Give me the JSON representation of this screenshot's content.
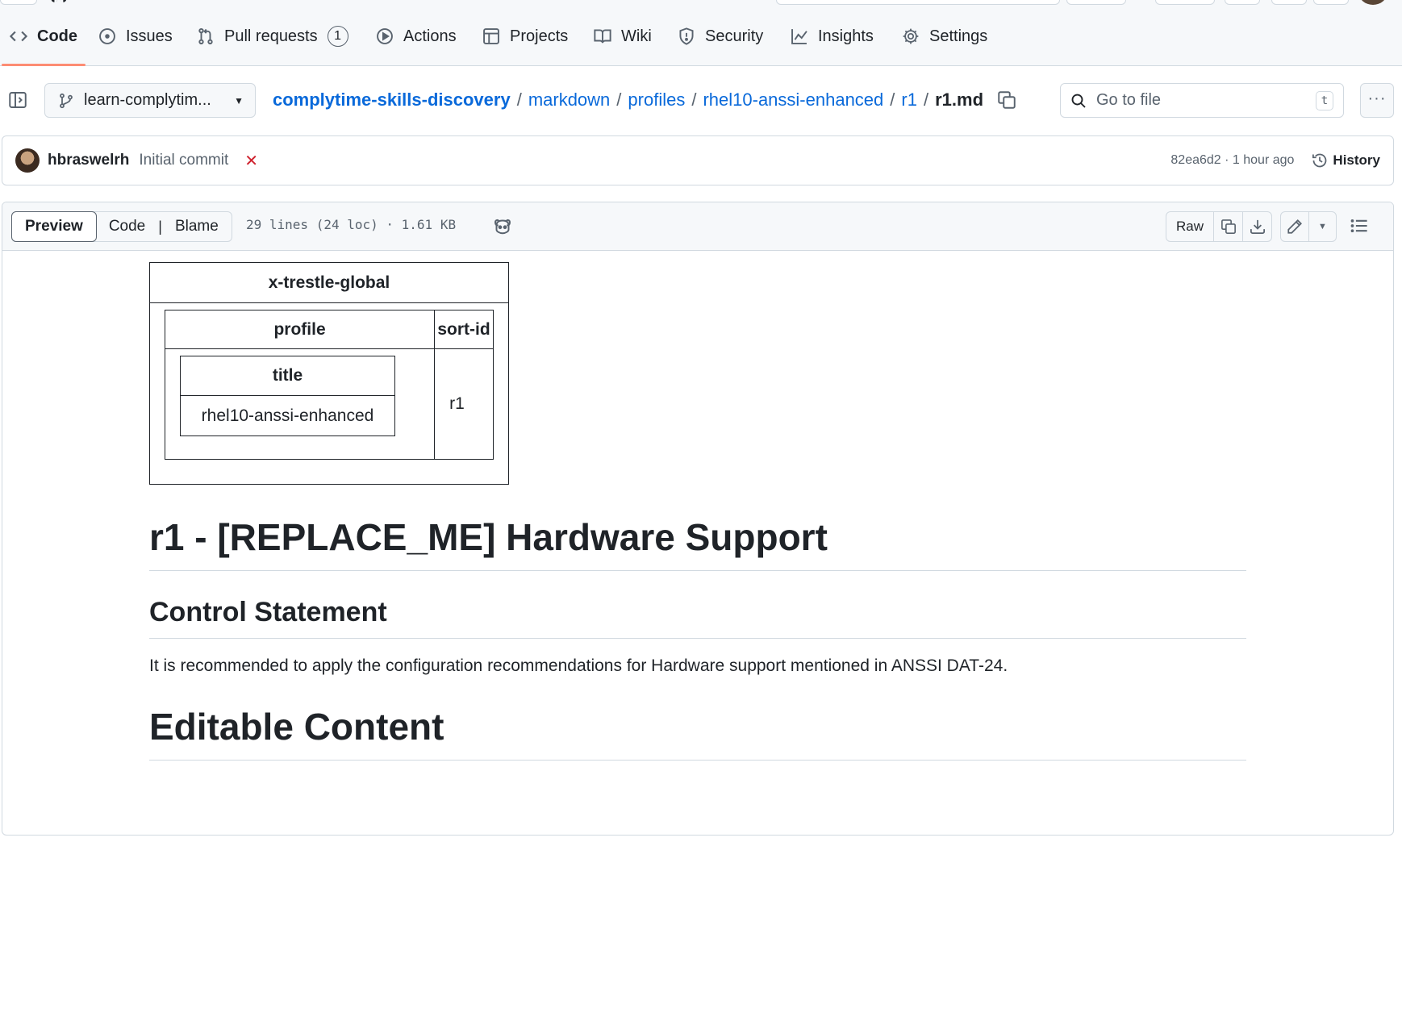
{
  "nav": {
    "items": [
      {
        "label": "Code",
        "icon": "code-icon"
      },
      {
        "label": "Issues",
        "icon": "issue-icon"
      },
      {
        "label": "Pull requests",
        "icon": "pull-request-icon",
        "count": "1"
      },
      {
        "label": "Actions",
        "icon": "play-icon"
      },
      {
        "label": "Projects",
        "icon": "table-icon"
      },
      {
        "label": "Wiki",
        "icon": "book-icon"
      },
      {
        "label": "Security",
        "icon": "shield-icon"
      },
      {
        "label": "Insights",
        "icon": "graph-icon"
      },
      {
        "label": "Settings",
        "icon": "gear-icon"
      }
    ]
  },
  "file_header": {
    "branch": "learn-complytim...",
    "breadcrumb": [
      "complytime-skills-discovery",
      "markdown",
      "profiles",
      "rhel10-anssi-enhanced",
      "r1"
    ],
    "filename": "r1.md",
    "goto_placeholder": "Go to file",
    "goto_shortcut": "t"
  },
  "commit": {
    "author": "hbraswelrh",
    "message": "Initial commit",
    "status": "failed",
    "sha": "82ea6d2",
    "time": "1 hour ago",
    "history_label": "History"
  },
  "file_toolbar": {
    "tabs": [
      "Preview",
      "Code",
      "Blame"
    ],
    "active_tab": "Preview",
    "info": "29 lines (24 loc) · 1.61 KB",
    "raw_label": "Raw"
  },
  "content": {
    "table": {
      "outer_header": "x-trestle-global",
      "mid_headers": [
        "profile",
        "sort-id"
      ],
      "inner_header": "title",
      "inner_value": "rhel10-anssi-enhanced",
      "sort_id_value": "r1"
    },
    "h1": "r1 - [REPLACE_ME] Hardware Support",
    "h2": "Control Statement",
    "paragraph": "It is recommended to apply the configuration recommendations for Hardware support mentioned in ANSSI DAT-24.",
    "h1b": "Editable Content"
  },
  "colors": {
    "accent_underline": "#fd8c73",
    "link": "#0969da",
    "danger": "#cf222e"
  }
}
